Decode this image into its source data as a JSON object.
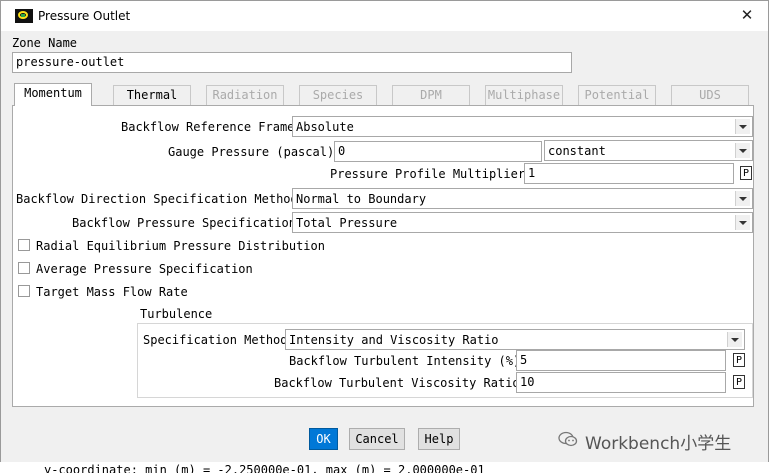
{
  "window": {
    "title": "Pressure Outlet",
    "close_glyph": "✕"
  },
  "zone": {
    "label": "Zone Name",
    "value": "pressure-outlet"
  },
  "tabs": [
    {
      "label": "Momentum",
      "state": "active"
    },
    {
      "label": "Thermal",
      "state": "enabled"
    },
    {
      "label": "Radiation",
      "state": "disabled"
    },
    {
      "label": "Species",
      "state": "disabled"
    },
    {
      "label": "DPM",
      "state": "disabled"
    },
    {
      "label": "Multiphase",
      "state": "disabled"
    },
    {
      "label": "Potential",
      "state": "disabled"
    },
    {
      "label": "UDS",
      "state": "disabled"
    }
  ],
  "momentum": {
    "backflow_ref_frame": {
      "label": "Backflow Reference Frame",
      "value": "Absolute"
    },
    "gauge_pressure": {
      "label": "Gauge Pressure (pascal)",
      "value": "0",
      "method": "constant"
    },
    "profile_multiplier": {
      "label": "Pressure Profile Multiplier",
      "value": "1",
      "param": "P"
    },
    "backflow_direction": {
      "label": "Backflow Direction Specification Method",
      "value": "Normal to Boundary"
    },
    "backflow_pressure": {
      "label": "Backflow Pressure Specification",
      "value": "Total Pressure"
    },
    "checkboxes": [
      {
        "label": "Radial Equilibrium Pressure Distribution",
        "checked": false
      },
      {
        "label": "Average Pressure Specification",
        "checked": false
      },
      {
        "label": "Target Mass Flow Rate",
        "checked": false
      }
    ],
    "turbulence": {
      "heading": "Turbulence",
      "spec_method": {
        "label": "Specification Method",
        "value": "Intensity and Viscosity Ratio"
      },
      "intensity": {
        "label": "Backflow Turbulent Intensity (%)",
        "value": "5",
        "param": "P"
      },
      "viscosity_ratio": {
        "label": "Backflow Turbulent Viscosity Ratio",
        "value": "10",
        "param": "P"
      }
    }
  },
  "buttons": {
    "ok": "OK",
    "cancel": "Cancel",
    "help": "Help"
  },
  "watermark": "Workbench小学生",
  "console_line": "y-coordinate: min (m) = -2.250000e-01, max (m) = 2.000000e-01",
  "colors": {
    "accent": "#0078d7",
    "icon_bg": "#111111",
    "icon_ring": "#ffe21a",
    "icon_dot": "#2aa84a"
  }
}
